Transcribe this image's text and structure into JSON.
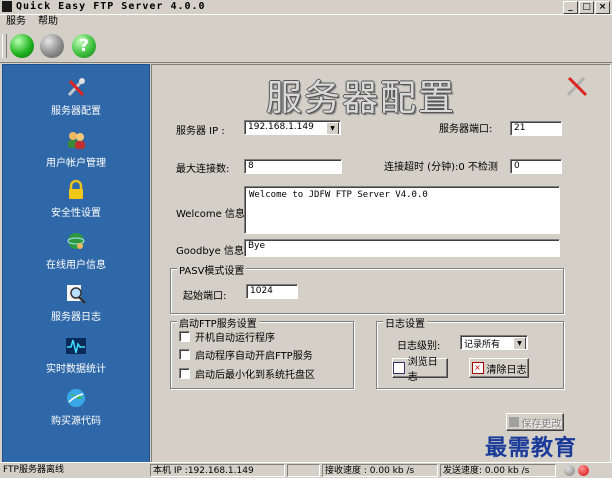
{
  "window": {
    "title": "Quick Easy FTP Server 4.0.0",
    "controls": [
      "_",
      "□",
      "×"
    ]
  },
  "menu": {
    "items": [
      "服务",
      "帮助"
    ]
  },
  "toolbar": {
    "help_glyph": "?"
  },
  "sidebar": {
    "items": [
      {
        "label": "服务器配置",
        "icon": "wrench-screwdriver-icon"
      },
      {
        "label": "用户帐户管理",
        "icon": "users-icon"
      },
      {
        "label": "安全性设置",
        "icon": "lock-icon"
      },
      {
        "label": "在线用户信息",
        "icon": "globe-user-icon"
      },
      {
        "label": "服务器日志",
        "icon": "magnifier-icon"
      },
      {
        "label": "实时数据统计",
        "icon": "pulse-chart-icon"
      },
      {
        "label": "购买源代码",
        "icon": "globe-icon"
      }
    ]
  },
  "config": {
    "heading": "服务器配置",
    "server_ip_label": "服务器 IP :",
    "server_ip_value": "192.168.1.149",
    "server_port_label": "服务器端口:",
    "server_port_value": "21",
    "max_conn_label": "最大连接数:",
    "max_conn_value": "8",
    "timeout_label": "连接超时 (分钟):0 不检测",
    "timeout_value": "0",
    "welcome_label": "Welcome 信息:",
    "welcome_value": "Welcome to JDFW  FTP Server V4.0.0",
    "goodbye_label": "Goodbye 信息:",
    "goodbye_value": "Bye",
    "pasv_group": "PASV模式设置",
    "start_port_label": "起始端口:",
    "start_port_value": "1024",
    "startup_group": "启动FTP服务设置",
    "startup_options": [
      "开机自动运行程序",
      "启动程序自动开启FTP服务",
      "启动后最小化到系统托盘区"
    ],
    "log_group": "日志设置",
    "log_level_label": "日志级别:",
    "log_level_value": "记录所有",
    "browse_log_button": "浏览日志",
    "clear_log_button": "清除日志",
    "save_button": "保存更改"
  },
  "watermark": "最需教育",
  "status": {
    "server_state": "FTP服务器离线",
    "local_ip": "本机 IP :192.168.1.149",
    "recv_speed": "接收速度 : 0.00   kb /s",
    "send_speed": "发送速度: 0.00   kb /s"
  },
  "colors": {
    "sidebar": "#2f68a8",
    "watermark": "#1a3a9a",
    "led_green": "#22b422",
    "led_red": "#d01010"
  }
}
